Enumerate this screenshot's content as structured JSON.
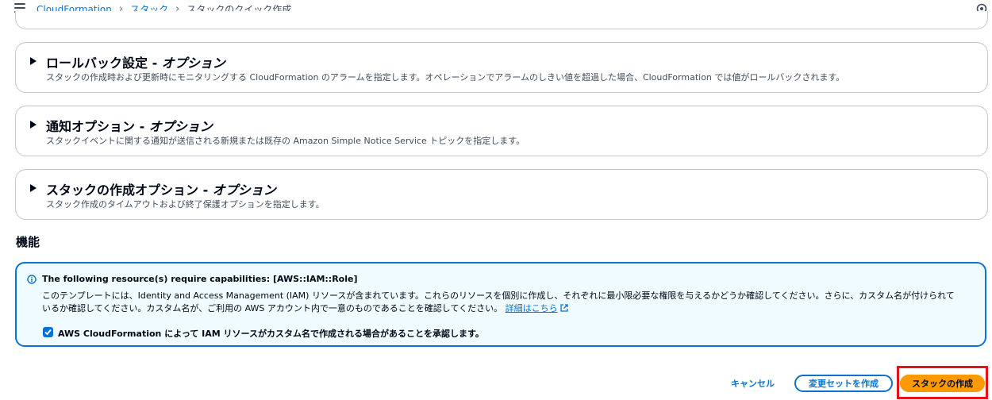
{
  "breadcrumb": {
    "items": [
      "CloudFormation",
      "スタック"
    ],
    "current": "スタックのクイック作成"
  },
  "panels": [
    {
      "title": "ロールバック設定",
      "optional": "オプション",
      "description": "スタックの作成時および更新時にモニタリングする CloudFormation のアラームを指定します。オペレーションでアラームのしきい値を超過した場合、CloudFormation では値がロールバックされます。"
    },
    {
      "title": "通知オプション",
      "optional": "オプション",
      "description": "スタックイベントに関する通知が送信される新規または既存の Amazon Simple Notice Service トピックを指定します。"
    },
    {
      "title": "スタックの作成オプション",
      "optional": "オプション",
      "description": "スタック作成のタイムアウトおよび終了保護オプションを指定します。"
    }
  ],
  "title_separator": " - ",
  "capabilities": {
    "heading": "機能",
    "alert_title": "The following resource(s) require capabilities: [AWS::IAM::Role]",
    "alert_body": "このテンプレートには、Identity and Access Management (IAM) リソースが含まれています。これらのリソースを個別に作成し、それぞれに最小限必要な権限を与えるかどうか確認してください。さらに、カスタム名が付けられているか確認してください。カスタム名が、ご利用の AWS アカウント内で一意のものであることを確認してください。",
    "learn_more": "詳細はこちら",
    "acknowledge_label": "AWS CloudFormation によって IAM リソースがカスタム名で作成される場合があることを承認します。",
    "acknowledged": true
  },
  "actions": {
    "cancel": "キャンセル",
    "create_change_set": "変更セットを作成",
    "create_stack": "スタックの作成"
  },
  "colors": {
    "link": "#0972d3",
    "primary": "#ff9900",
    "highlight": "#e4141b",
    "alert_bg": "#f0fbff"
  }
}
